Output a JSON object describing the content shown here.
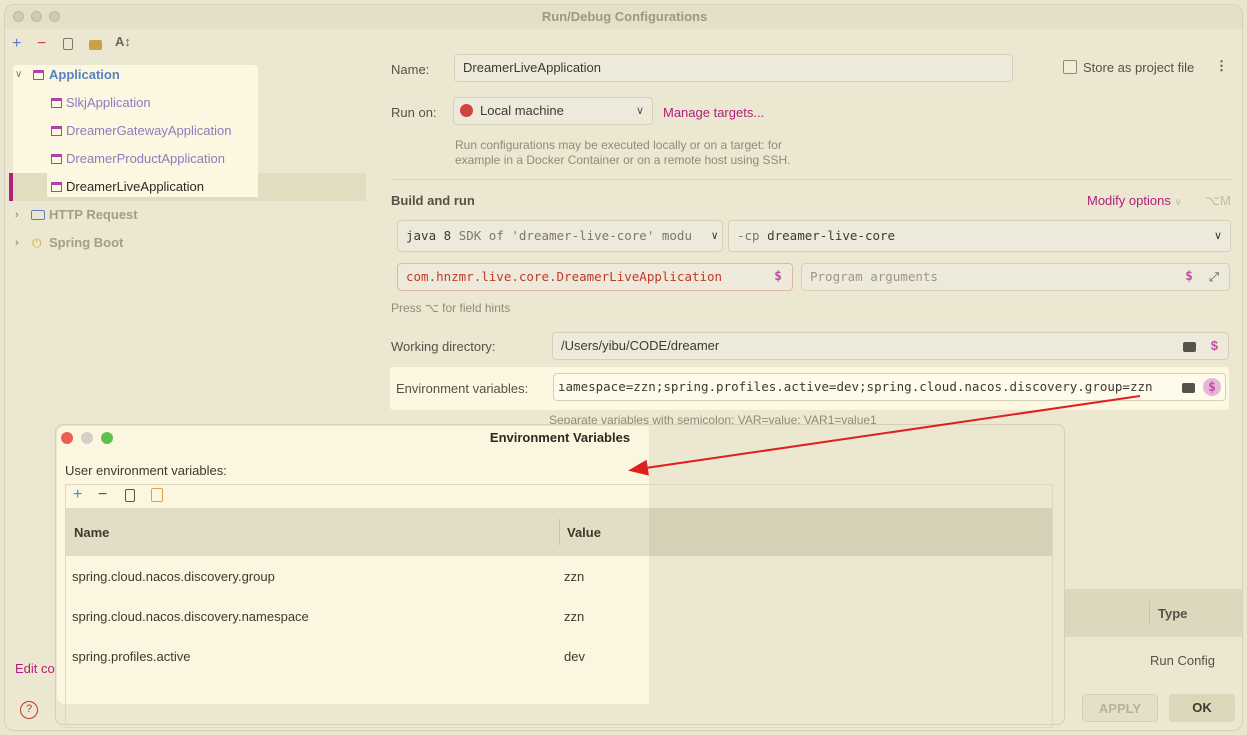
{
  "window": {
    "title": "Run/Debug Configurations"
  },
  "toolbar": {
    "add": "+",
    "remove": "−",
    "copy_icon": "copy-icon",
    "folder_icon": "folder-icon",
    "sort_icon": "sort-icon"
  },
  "tree": {
    "root": "Application",
    "children": [
      "SlkjApplication",
      "DreamerGatewayApplication",
      "DreamerProductApplication",
      "DreamerLiveApplication"
    ],
    "http": "HTTP Request",
    "spring": "Spring Boot",
    "edit": "Edit co",
    "help": "?"
  },
  "form": {
    "name_label": "Name:",
    "name_value": "DreamerLiveApplication",
    "store_label": "Store as project file",
    "run_on_label": "Run on:",
    "run_on_value": "Local machine",
    "manage_targets": "Manage targets...",
    "run_on_hint_1": "Run configurations may be executed locally or on a target: for",
    "run_on_hint_2": "example in a Docker Container or on a remote host using SSH.",
    "build_run": "Build and run",
    "modify_options": "Modify options",
    "modify_shortcut": "⌥M",
    "sdk_java": "java 8",
    "sdk_rest": "SDK of 'dreamer-live-core' modu",
    "cp_flag": "-cp",
    "cp_value": "dreamer-live-core",
    "main_class": "com.hnzmr.live.core.DreamerLiveApplication",
    "program_args_placeholder": "Program arguments",
    "field_hint": "Press ⌥ for field hints",
    "workdir_label": "Working directory:",
    "workdir_value": "/Users/yibu/CODE/dreamer",
    "env_label": "Environment variables:",
    "env_value": "ıamespace=zzn;spring.profiles.active=dev;spring.cloud.nacos.discovery.group=zzn",
    "env_hint": "Separate variables with semicolon: VAR=value; VAR1=value1",
    "dollar": "$"
  },
  "bg_table": {
    "type_header": "Type",
    "type_value": "Run Config"
  },
  "buttons": {
    "apply": "APPLY",
    "ok": "OK"
  },
  "env_dialog": {
    "title": "Environment Variables",
    "user_label": "User environment variables:",
    "col_name": "Name",
    "col_value": "Value",
    "rows": [
      {
        "name": "spring.cloud.nacos.discovery.group",
        "value": "zzn"
      },
      {
        "name": "spring.cloud.nacos.discovery.namespace",
        "value": "zzn"
      },
      {
        "name": "spring.profiles.active",
        "value": "dev"
      }
    ]
  },
  "colors": {
    "accent": "#b01f78",
    "link": "#b01f78",
    "arrow": "#e02020",
    "highlight": "#fcf7e0"
  }
}
